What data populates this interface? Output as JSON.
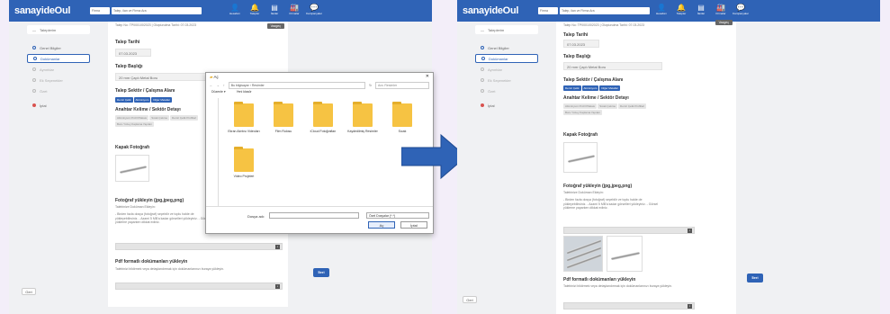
{
  "header": {
    "logo": "sanayideOul",
    "select_value": "Firma",
    "search_placeholder": "Talep, ilan ve Firma Ara",
    "icons": [
      {
        "name": "user-icon",
        "glyph": "👤",
        "label": "Hesabım"
      },
      {
        "name": "bell-icon",
        "glyph": "🔔",
        "label": "Talepler"
      },
      {
        "name": "doc-icon",
        "glyph": "▤",
        "label": "İlanlar"
      },
      {
        "name": "factory-icon",
        "glyph": "🏭",
        "label": "Firmalar"
      },
      {
        "name": "chat-icon",
        "glyph": "💬",
        "label": "Kampanyalar"
      }
    ]
  },
  "sidebar": {
    "back": "Taleplerim",
    "items": [
      {
        "label": "Genel Bilgiler",
        "state": "normal"
      },
      {
        "label": "Dokümanlar",
        "state": "active"
      },
      {
        "label": "Ayrıntılar",
        "state": "dim"
      },
      {
        "label": "Ek Seçenekler",
        "state": "dim"
      },
      {
        "label": "Özet",
        "state": "dim"
      },
      {
        "label": "İptal",
        "state": "red"
      }
    ],
    "back_button": "Geri"
  },
  "form": {
    "crumb": "Talep No: TP0001002023   |   Oluşturulma Tarihi: 07.03.2023",
    "cancel_button": "Vazgeç",
    "date_label": "Talep Tarihi",
    "date_value": "07.03.2023",
    "title_label": "Talep Başlığı",
    "title_value": "20 mm Çaplı Metal Boru",
    "sector_label": "Talep Sektör / Çalışma Alanı",
    "sectors": [
      "Demir Çelik",
      "Alüminyum",
      "Diğer Metaller"
    ],
    "keywords_label": "Anahtar Kelime / Sektör Detayı",
    "keywords": [
      "Alüminyum Profil Plakası",
      "Sıcak Çekme",
      "Demir Çelik Profilleri",
      "Boru Yüzey Kaplama Yapıları",
      "Metal Boru"
    ],
    "cover_label": "Kapak Fotoğrafı",
    "upload_img_label": "Fotoğraf yükleyin (jpg,jpeg,png)",
    "upload_img_sub": "Talebinize Doküman Ekleyin:",
    "upload_img_note": "- Birden fazla dosya (fotoğraf) seçebilir ve toplu halde de yükleyebilirsiniz. - Azami 5 MB'a kadar görselleri yükleyiniz. - Görsel yükleme yaparken dikkat ediniz.",
    "pdf_label": "Pdf formatlı dokümanları yükleyin",
    "pdf_note": "Talebinizi bildirmek veya detaylandırmak için dokümanlarınızı buraya yükleyin.",
    "next_button": "İleri"
  },
  "dialog": {
    "title": "Aç",
    "path": "Bu bilgisayar  ›  Resimler",
    "search_placeholder": "Ara: Resimler",
    "organize": "Düzenle ▾",
    "new_folder": "Yeni klasör",
    "folders": [
      "Ekran Alıntısı Videoları",
      "Film Rulosu",
      "iCloud Fotoğrafları",
      "Kaydedilmiş Resimler",
      "Sıcak",
      "Video Projeleri"
    ],
    "filename_label": "Dosya adı:",
    "filter": "Özel Dosyalar (*.*)",
    "open_button": "Aç",
    "cancel_button": "İptal"
  },
  "colors": {
    "primary": "#2f63b6",
    "folder": "#f6c343",
    "background": "#f3eef9",
    "arrow": "#2f63b6"
  }
}
